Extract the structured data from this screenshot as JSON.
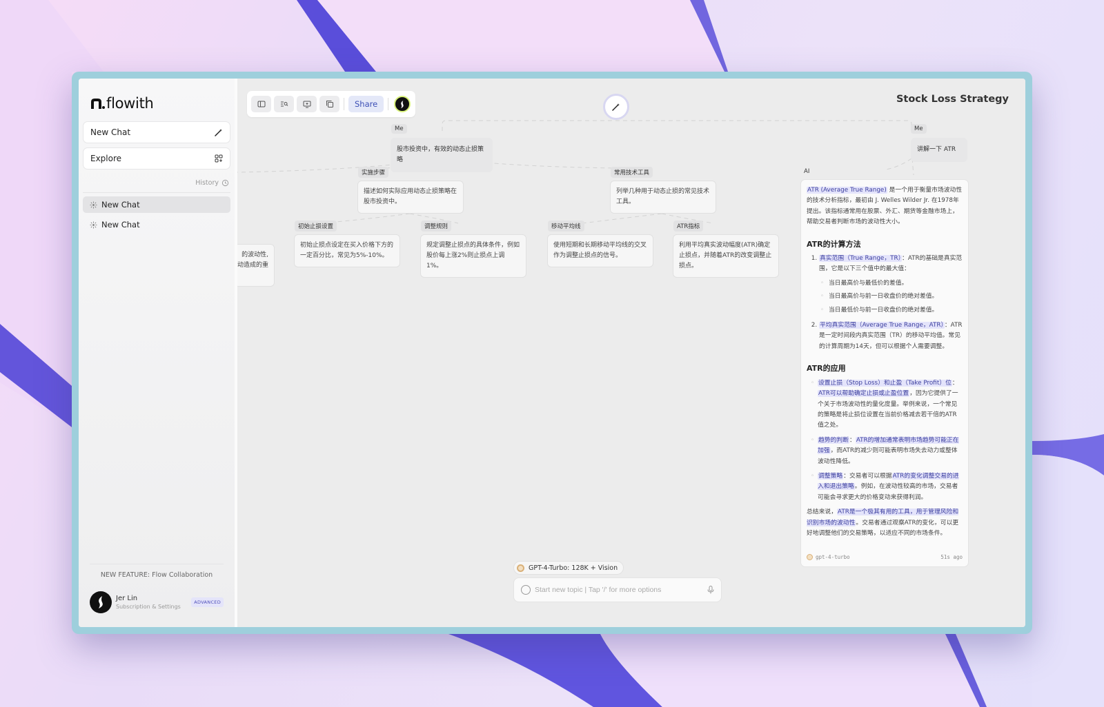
{
  "app": {
    "name": "flowith",
    "title": "Stock Loss Strategy"
  },
  "sidebar": {
    "new_chat_label": "New Chat",
    "explore_label": "Explore",
    "history_label": "History",
    "chats": [
      {
        "label": "New Chat"
      },
      {
        "label": "New Chat"
      }
    ],
    "feature_text": "NEW FEATURE: Flow Collaboration",
    "user": {
      "name": "Jer Lin",
      "subtitle": "Subscription & Settings",
      "badge": "ADVANCED"
    }
  },
  "toolbar": {
    "share_label": "Share"
  },
  "flow": {
    "q1": {
      "label": "Me",
      "text": "股市投资中，有效的动态止损策略"
    },
    "q2": {
      "label": "Me",
      "text": "讲解一下 ATR"
    },
    "ai_label": "AI",
    "branches": [
      {
        "label": "实施步骤",
        "text": "描述如何实际应用动态止损策略在股市投资中。"
      },
      {
        "label": "常用技术工具",
        "text": "列举几种用于动态止损的常见技术工具。"
      }
    ],
    "leaves": [
      {
        "label": "初始止损设置",
        "text": "初始止损点设定在买入价格下方的一定百分比，常见为5%-10%。"
      },
      {
        "label": "调整规则",
        "text": "规定调整止损点的具体条件，例如股价每上涨2%则止损点上调1%。"
      },
      {
        "label": "移动平均线",
        "text": "使用短期和长期移动平均线的交叉作为调整止损点的信号。"
      },
      {
        "label": "ATR指标",
        "text": "利用平均真实波动幅度(ATR)确定止损点，并随着ATR的改变调整止损点。"
      }
    ],
    "partial_node": {
      "line1": "的波动性,",
      "line2": "动造成的重"
    }
  },
  "answer": {
    "intro_hl": "ATR (Average True Range)",
    "intro_rest": "是一个用于衡量市场波动性的技术分析指标，最初由 J. Welles Wilder Jr. 在1978年提出。该指标通常用在股票、外汇、期货等金融市场上，帮助交易者判断市场的波动性大小。",
    "h_calc": "ATR的计算方法",
    "calc1_hl": "真实范围（True Range，TR）",
    "calc1_rest": "：ATR的基础是真实范围，它是以下三个值中的最大值：",
    "calc1_subs": [
      "当日最高价与最低价的差值。",
      "当日最高价与前一日收盘价的绝对差值。",
      "当日最低价与前一日收盘价的绝对差值。"
    ],
    "calc2_hl": "平均真实范围（Average True Range，ATR）",
    "calc2_rest": "：ATR是一定时间段内真实范围（TR）的移动平均值。常见的计算周期为14天，但可以根据个人需要调整。",
    "h_app": "ATR的应用",
    "app1_hl1": "设置止损（Stop Loss）和止盈（Take Profit）位",
    "app1_mid": "：",
    "app1_hl2": "ATR可以帮助确定止损或止盈位置",
    "app1_rest": "，因为它提供了一个关于市场波动性的量化度量。举例来说，一个常见的策略是将止损位设置在当前价格减去若干倍的ATR值之处。",
    "app2_hl1": "趋势的判断",
    "app2_mid": "：",
    "app2_hl2": "ATR的增加通常表明市场趋势可能正在加强",
    "app2_rest": "，而ATR的减少则可能表明市场失去动力或整体波动性降低。",
    "app3_hl1": "调整策略",
    "app3_mid": "：交易者可以根据",
    "app3_hl2": "ATR的变化调整交易的进入和退出策略",
    "app3_rest": "。例如，在波动性较高的市场，交易者可能会寻求更大的价格变动来获得利润。",
    "summary_pre": "总结来说，",
    "summary_hl": "ATR是一个极其有用的工具，用于管理风险和识别市场的波动性",
    "summary_rest": "。交易者通过观察ATR的变化，可以更好地调整他们的交易策略，以适应不同的市场条件。",
    "model": "gpt-4-turbo",
    "time": "51s ago"
  },
  "composer": {
    "model_label": "GPT-4-Turbo: 128K + Vision",
    "placeholder": "Start new topic | Tap '/' for more options"
  },
  "colors": {
    "accent": "#3c4fb5",
    "highlight": "#e4e4fb",
    "frame": "#9ecfdc"
  }
}
